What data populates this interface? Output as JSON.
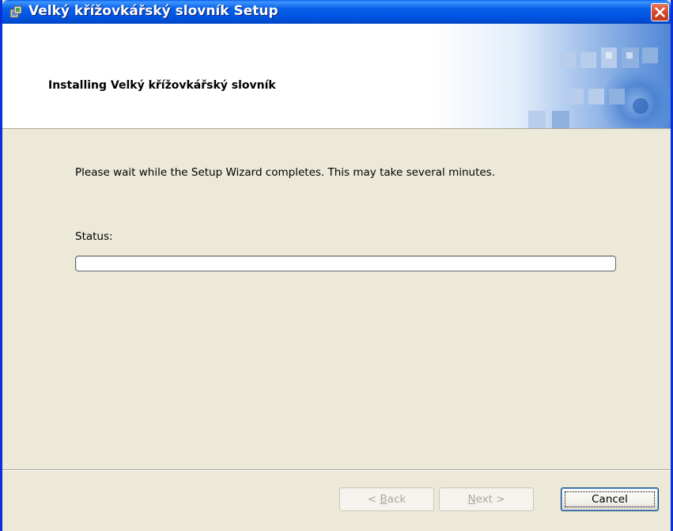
{
  "window": {
    "title": "Velký křížovkářský slovník Setup",
    "icon": "setup-package-icon",
    "close_icon": "close-icon"
  },
  "header": {
    "title": "Installing Velký křížovkářský slovník",
    "banner": "blue-squares-banner"
  },
  "content": {
    "message": "Please wait while the Setup Wizard completes.  This may take several minutes.",
    "status_label": "Status:",
    "progress_percent": 0
  },
  "buttons": {
    "back": {
      "mnemonic": "B",
      "rest": "ack",
      "prefix": "< ",
      "label": "< Back",
      "enabled": false
    },
    "next": {
      "mnemonic": "N",
      "rest": "ext >",
      "label": "Next >",
      "enabled": false
    },
    "cancel": {
      "label": "Cancel",
      "enabled": true
    }
  },
  "colors": {
    "titlebar": "#0054E3",
    "window_frame": "#0831D9",
    "dialog_bg": "#ECE9D8",
    "close_button": "#D34A2A",
    "progress_fill": "#3DBD3D"
  }
}
